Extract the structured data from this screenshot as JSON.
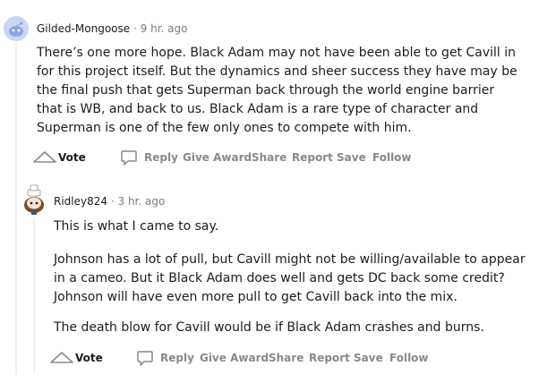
{
  "comments": [
    {
      "username": "Gilded-Mongoose",
      "separator": "·",
      "time": "9 hr. ago",
      "paragraphs": [
        "There’s one more hope. Black Adam may not have been able to get Cavill in for this project itself. But the dynamics and sheer success they have may be the final push that gets Superman back through the world engine barrier that is WB, and back to us. Black Adam is a rare type of character and Superman is one of the few only ones to compete with him."
      ],
      "actions": {
        "vote": "Vote",
        "reply": "Reply",
        "give_award": "Give Award",
        "share": "Share",
        "report": "Report",
        "save": "Save",
        "follow": "Follow"
      }
    },
    {
      "username": "Ridley824",
      "separator": "·",
      "time": "3 hr. ago",
      "paragraphs": [
        "This is what I came to say.",
        "Johnson has a lot of pull, but Cavill might not be willing/available to appear in a cameo. But it Black Adam does well and gets DC back some credit? Johnson will have even more pull to get Cavill back into the mix.",
        "The death blow for Cavill would be if Black Adam crashes and burns."
      ],
      "actions": {
        "vote": "Vote",
        "reply": "Reply",
        "give_award": "Give Award",
        "share": "Share",
        "report": "Report",
        "save": "Save",
        "follow": "Follow"
      }
    }
  ],
  "colors": {
    "accent_avatar_1": "#9fb3e6",
    "meta_gray": "#7c7c7c",
    "action_gray": "#878a8c",
    "thread_line": "#edeff1"
  }
}
